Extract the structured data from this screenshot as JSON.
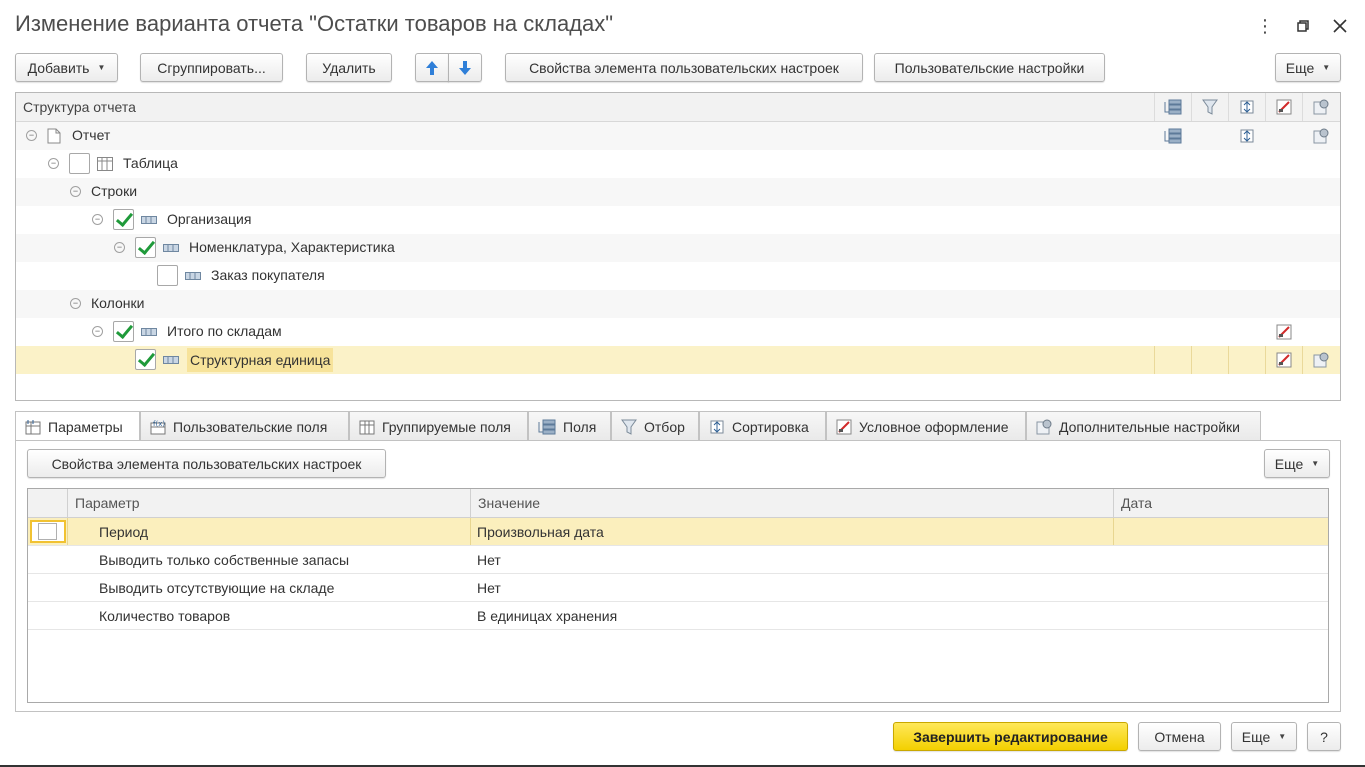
{
  "window": {
    "title": "Изменение варианта отчета \"Остатки товаров на складах\"",
    "controls": [
      "more-vert-icon",
      "restore-icon",
      "close-icon"
    ]
  },
  "toolbar": {
    "add": "Добавить",
    "group": "Сгруппировать...",
    "delete": "Удалить",
    "item_props": "Свойства элемента пользовательских настроек",
    "user_settings": "Пользовательские настройки",
    "more": "Еще"
  },
  "structure": {
    "header": "Структура отчета",
    "header_icons": [
      "fields-icon",
      "filter-icon",
      "sort-icon",
      "conditional-format-icon",
      "extra-settings-icon"
    ],
    "rows": [
      {
        "label": "Отчет",
        "checkbox": "none",
        "icon": "document-icon"
      },
      {
        "label": "Таблица",
        "checkbox": "unchecked",
        "icon": "table-icon"
      },
      {
        "label": "Строки",
        "checkbox": "none",
        "icon": ""
      },
      {
        "label": "Организация",
        "checkbox": "checked",
        "icon": "grouping-icon"
      },
      {
        "label": "Номенклатура, Характеристика",
        "checkbox": "checked",
        "icon": "grouping-icon"
      },
      {
        "label": "Заказ покупателя",
        "checkbox": "unchecked",
        "icon": "grouping-icon"
      },
      {
        "label": "Колонки",
        "checkbox": "none",
        "icon": ""
      },
      {
        "label": "Итого по складам",
        "checkbox": "checked",
        "icon": "grouping-icon"
      },
      {
        "label": "Структурная единица",
        "checkbox": "checked",
        "icon": "grouping-icon",
        "selected": true
      }
    ]
  },
  "tabs": [
    {
      "label": "Параметры",
      "icon": "params-icon",
      "active": true
    },
    {
      "label": "Пользовательские поля",
      "icon": "custom-fields-icon"
    },
    {
      "label": "Группируемые поля",
      "icon": "grouped-fields-icon"
    },
    {
      "label": "Поля",
      "icon": "fields-icon"
    },
    {
      "label": "Отбор",
      "icon": "filter-icon"
    },
    {
      "label": "Сортировка",
      "icon": "sort-icon"
    },
    {
      "label": "Условное оформление",
      "icon": "conditional-format-icon"
    },
    {
      "label": "Дополнительные настройки",
      "icon": "extra-settings-icon"
    }
  ],
  "params_panel": {
    "item_props": "Свойства элемента пользовательских настроек",
    "more": "Еще",
    "columns": [
      "Параметр",
      "Значение",
      "Дата"
    ],
    "rows": [
      {
        "param": "Период",
        "value": "Произвольная дата",
        "date": ""
      },
      {
        "param": "Выводить только собственные запасы",
        "value": "Нет",
        "date": ""
      },
      {
        "param": "Выводить отсутствующие на складе",
        "value": "Нет",
        "date": ""
      },
      {
        "param": "Количество товаров",
        "value": "В единицах хранения",
        "date": ""
      }
    ]
  },
  "footer": {
    "finish": "Завершить редактирование",
    "cancel": "Отмена",
    "more": "Еще",
    "help": "?"
  }
}
